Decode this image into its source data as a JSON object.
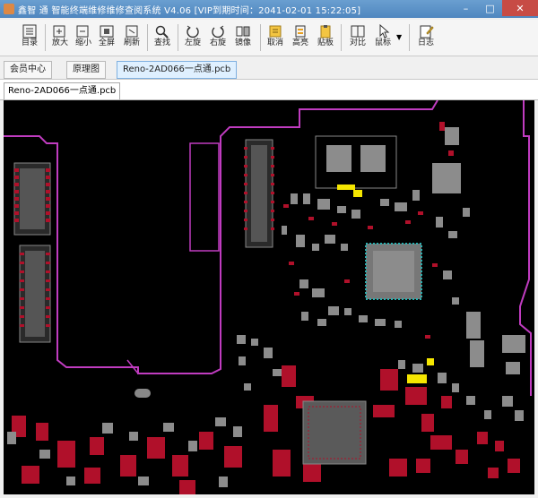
{
  "window": {
    "title": "鑫智 通 智能终端维修维修查阅系统 V4.06 [VIP到期时间：2041-02-01 15:22:05]",
    "minimize_glyph": "–",
    "maximize_glyph": "□",
    "close_glyph": "✕"
  },
  "toolbar": {
    "items": [
      {
        "label": "目录",
        "icon": "catalog-icon"
      },
      {
        "label": "放大",
        "icon": "zoom-in-icon"
      },
      {
        "label": "缩小",
        "icon": "zoom-out-icon"
      },
      {
        "label": "全屏",
        "icon": "fullscreen-icon"
      },
      {
        "label": "刷新",
        "icon": "refresh-icon"
      },
      {
        "label": "查找",
        "icon": "search-icon"
      },
      {
        "label": "左旋",
        "icon": "rotate-left-icon"
      },
      {
        "label": "右旋",
        "icon": "rotate-right-icon"
      },
      {
        "label": "镜像",
        "icon": "mirror-icon"
      },
      {
        "label": "取消",
        "icon": "cancel-icon"
      },
      {
        "label": "高亮",
        "icon": "highlight-icon"
      },
      {
        "label": "贴板",
        "icon": "clipboard-icon"
      },
      {
        "label": "对比",
        "icon": "compare-icon"
      },
      {
        "label": "鼠标",
        "icon": "pointer-icon"
      },
      {
        "label": "日志",
        "icon": "log-icon"
      }
    ]
  },
  "tabs": {
    "primary": [
      "会员中心",
      "原理图",
      "Reno-2AD066一点通.pcb"
    ],
    "document": "Reno-2AD066一点通.pcb"
  },
  "colors": {
    "board_bg": "#000000",
    "outline": "#c03cc0",
    "pad_gray": "#8c8c8c",
    "pad_red": "#b0102a",
    "highlight": "#f5e600",
    "cyan": "#2ab0b0"
  }
}
